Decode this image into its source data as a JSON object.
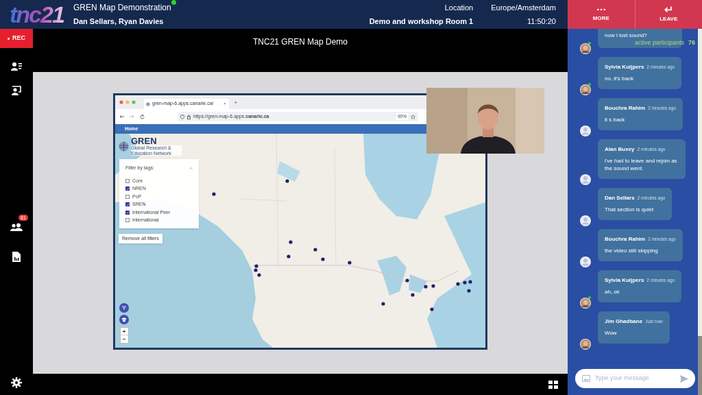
{
  "header": {
    "logo": "tnc21",
    "title": "GREN Map Demonstration",
    "live": true,
    "presenters": "Dan Sellars, Ryan Davies",
    "location_label": "Location",
    "location": "Demo and workshop Room 1",
    "timezone": "Europe/Amsterdam",
    "time": "11:50:20",
    "actions": [
      {
        "kind": "more",
        "label": "MORE"
      },
      {
        "kind": "leave",
        "label": "LEAVE"
      }
    ]
  },
  "recording": {
    "label": "REC"
  },
  "sidebar": {
    "participants_badge": "81"
  },
  "stage": {
    "title": "TNC21 GREN Map Demo",
    "browser": {
      "tab_title": "gren-map-6.apps.canarie.ca/",
      "tab_close": "×",
      "new_tab": "+",
      "url": "https://gren-map-6.apps.**canarie.ca**",
      "zoom": "90%",
      "nav": [
        "Home"
      ],
      "brand": "GREN",
      "brand_subtitle": "Global Research & Education Network",
      "filter": {
        "title": "Filter by tags:",
        "expanded": true,
        "tags": [
          {
            "label": "Core",
            "checked": false
          },
          {
            "label": "NREN",
            "checked": true
          },
          {
            "label": "PoP",
            "checked": false
          },
          {
            "label": "SREN",
            "checked": true
          },
          {
            "label": "International Peer",
            "checked": true
          },
          {
            "label": "International",
            "checked": false
          }
        ]
      },
      "remove_filters": "Remove all filters",
      "zoom_in": "+",
      "zoom_out": "−"
    }
  },
  "chat": {
    "active_label": "active participants",
    "active_count": "76",
    "messages": [
      {
        "text": "now i lost sound?",
        "online": true
      },
      {
        "author": "Sylvia Kuijpers",
        "time": "2 minutes ago",
        "text": "no, it's back",
        "online": true
      },
      {
        "author": "Bouchra Rahim",
        "time": "2 minutes ago",
        "text": "it s back",
        "kind": "default",
        "online": false
      },
      {
        "author": "Alan Buxey",
        "time": "2 minutes ago",
        "text": "i've had to leave and rejoin as the sound went.",
        "kind": "default",
        "online": false
      },
      {
        "author": "Dan Sellars",
        "time": "2 minutes ago",
        "text": "That section is quiet",
        "kind": "default",
        "online": false
      },
      {
        "author": "Bouchra Rahim",
        "time": "2 minutes ago",
        "text": "the video still skipping",
        "kind": "default",
        "online": false
      },
      {
        "author": "Sylvia Kuijpers",
        "time": "2 minutes ago",
        "text": "ah, ok",
        "online": true
      },
      {
        "author": "Jim Ghadbane",
        "time": "Just now",
        "text": "Wow",
        "online": false
      }
    ],
    "input": {
      "placeholder": "Type your message"
    }
  }
}
